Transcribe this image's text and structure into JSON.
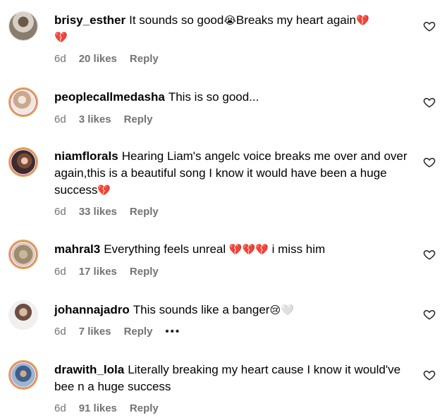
{
  "comments": [
    {
      "username": "brisy_esther",
      "text_before": "It sounds so good",
      "emoji1": "😭",
      "text_mid": "Breaks my heart again",
      "emoji2": "💔",
      "emoji3": "💔",
      "time": "6d",
      "likes": "20 likes",
      "reply": "Reply"
    },
    {
      "username": "peoplecallmedasha",
      "text": "This is so good...",
      "time": "6d",
      "likes": "3 likes",
      "reply": "Reply"
    },
    {
      "username": "niamflorals",
      "text": "Hearing Liam's angelc voice breaks me over and over again,this is a beautiful song I know it would have been a huge success",
      "emoji": "💔",
      "time": "6d",
      "likes": "33 likes",
      "reply": "Reply"
    },
    {
      "username": "mahral3",
      "text_before": "Everything feels unreal",
      "emojis": "💔💔💔",
      "text_after": "i miss him",
      "time": "6d",
      "likes": "17 likes",
      "reply": "Reply"
    },
    {
      "username": "johannajadro",
      "text": "This sounds like a banger",
      "emoji": "😢🤍",
      "time": "6d",
      "likes": "7 likes",
      "reply": "Reply",
      "more": "•••"
    },
    {
      "username": "drawith_lola",
      "text": "Literally breaking my heart cause I know it would've bee n a huge success",
      "time": "6d",
      "likes": "91 likes",
      "reply": "Reply"
    }
  ],
  "colors": {
    "meta": "#737373",
    "ring_gold": "#e2a94a",
    "ring_pink": "#d64a8b"
  },
  "icons": {
    "like": "heart-outline-icon"
  }
}
